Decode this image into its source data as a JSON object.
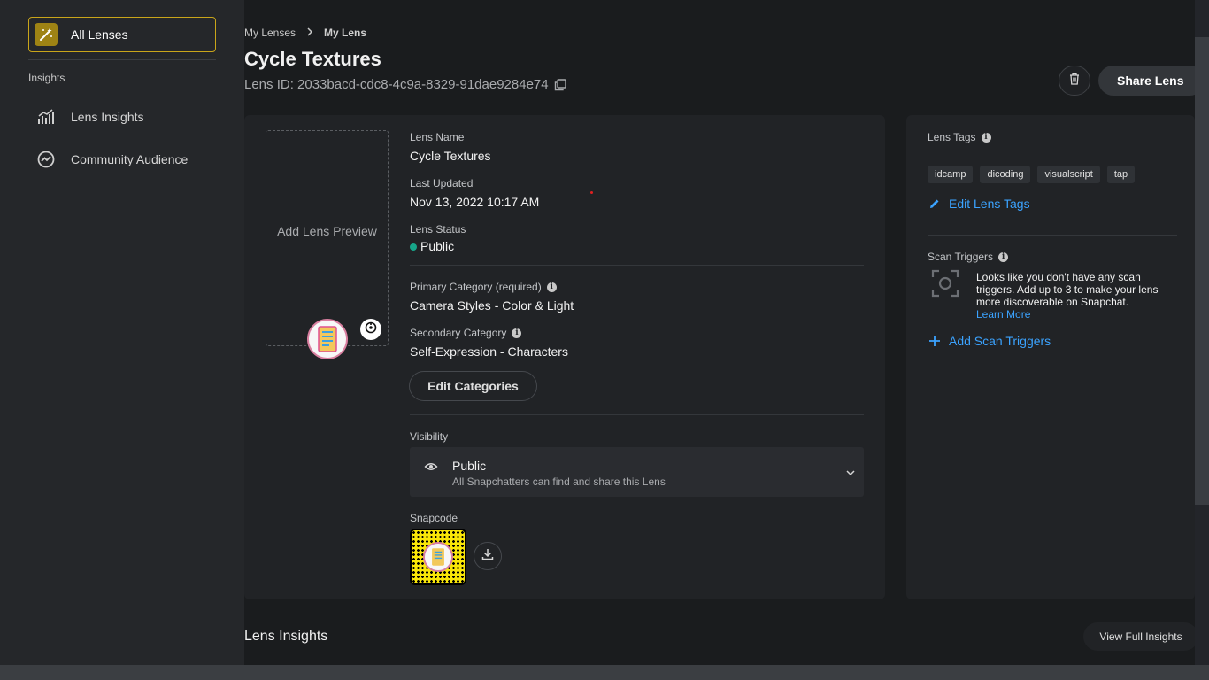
{
  "sidebar": {
    "all_lenses": "All Lenses",
    "insights_heading": "Insights",
    "items": [
      {
        "label": "Lens Insights",
        "icon": "bar-chart-icon"
      },
      {
        "label": "Community Audience",
        "icon": "trend-icon"
      }
    ]
  },
  "breadcrumb": {
    "parent": "My Lenses",
    "current": "My Lens"
  },
  "header": {
    "title": "Cycle Textures",
    "lens_id": "Lens ID: 2033bacd-cdc8-4c9a-8329-91dae9284e74",
    "share_label": "Share Lens"
  },
  "preview": {
    "label": "Add Lens Preview"
  },
  "details": {
    "name_label": "Lens Name",
    "name_value": "Cycle Textures",
    "updated_label": "Last Updated",
    "updated_value": "Nov 13, 2022 10:17 AM",
    "status_label": "Lens Status",
    "status_value": "Public",
    "primary_label": "Primary Category (required)",
    "primary_value": "Camera Styles - Color & Light",
    "secondary_label": "Secondary Category",
    "secondary_value": "Self-Expression - Characters",
    "edit_categories": "Edit Categories",
    "visibility_label": "Visibility",
    "visibility_title": "Public",
    "visibility_sub": "All Snapchatters can find and share this Lens",
    "snapcode_label": "Snapcode"
  },
  "tags": {
    "label": "Lens Tags",
    "items": [
      "idcamp",
      "dicoding",
      "visualscript",
      "tap"
    ],
    "edit_label": "Edit Lens Tags"
  },
  "scan": {
    "label": "Scan Triggers",
    "text": "Looks like you don't have any scan triggers. Add up to 3 to make your lens more discoverable on Snapchat.",
    "learn_more": "Learn More",
    "add_label": "Add Scan Triggers"
  },
  "insights": {
    "title": "Lens Insights",
    "view_full": "View Full Insights"
  },
  "colors": {
    "accent": "#c9a51a",
    "link": "#3ba3ff",
    "status_public": "#17a589"
  }
}
